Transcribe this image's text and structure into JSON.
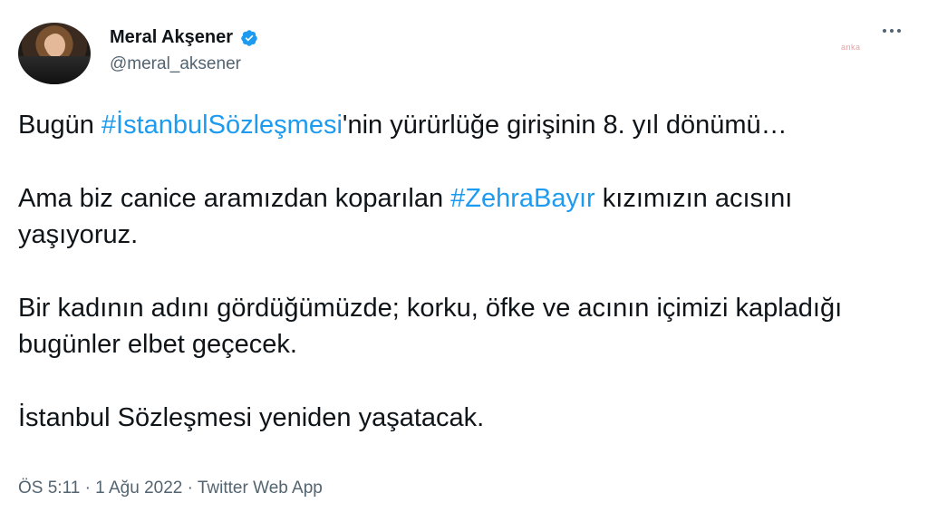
{
  "author": {
    "display_name": "Meral Akşener",
    "handle": "@meral_aksener",
    "verified": true
  },
  "watermark": "anka",
  "tweet": {
    "para1": {
      "pre": "Bugün ",
      "hashtag": "#İstanbulSözleşmesi",
      "post": "'nin yürürlüğe girişinin 8. yıl dönümü…"
    },
    "para2": {
      "pre": "Ama biz canice aramızdan koparılan ",
      "hashtag": "#ZehraBayır",
      "post": " kızımızın acısını yaşıyoruz."
    },
    "para3": "Bir kadının adını gördüğümüzde; korku, öfke ve acının içimizi kapladığı bugünler elbet geçecek.",
    "para4": "İstanbul Sözleşmesi yeniden yaşatacak."
  },
  "meta": "ÖS 5:11 · 1 Ağu 2022 · Twitter Web App",
  "icons": {
    "verified": "verified-badge-icon",
    "more": "more-options-icon"
  },
  "colors": {
    "hashtag": "#1d9bf0",
    "secondary": "#536471",
    "text": "#0f1419"
  }
}
